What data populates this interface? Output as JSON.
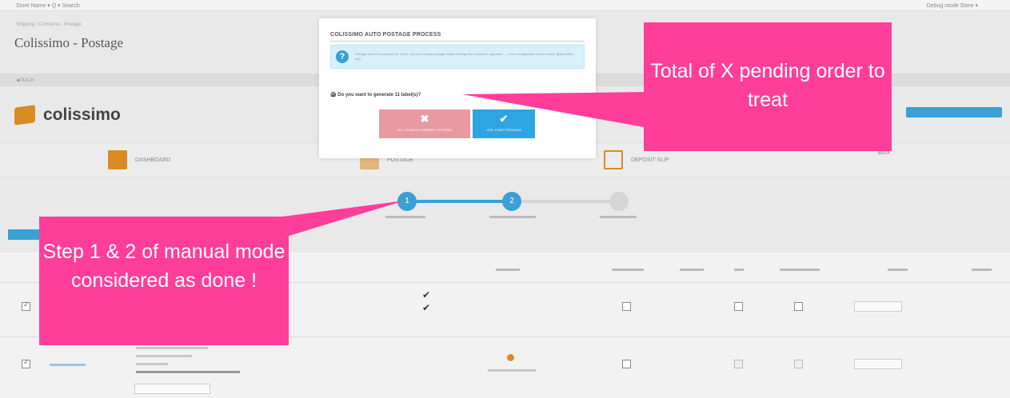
{
  "topbar": {
    "shop_label": "Store Name ▾   Q ▾   Search",
    "right_label": "Debug mode   Store ▾"
  },
  "breadcrumb": "Shipping  /  Colissimo - Postage",
  "page_title": "Colissimo - Postage",
  "subbar_label": "◀ BACK",
  "logo_text": "colissimo",
  "tabs": [
    {
      "label": "DASHBOARD",
      "icon": "dashboard-icon"
    },
    {
      "label": "POSTAGE",
      "icon": "postage-icon"
    },
    {
      "label": "DEPOSIT SLIP",
      "icon": "deposit-slip-icon"
    },
    {
      "label": "BOX",
      "icon": "box-icon"
    }
  ],
  "steps": [
    "1",
    "2",
    ""
  ],
  "modal": {
    "title": "COLISSIMO AUTO POSTAGE PROCESS",
    "info_text": "Postage mode is configured to \"Auto\". You can change postage default settings like insurance, signature, ... in the configuration of the module (Back-Office tab).",
    "info_icon": "question-icon",
    "question": "🖨 Do you want to generate 11 label(s)?",
    "no_glyph": "✖",
    "no_label": "NO, GO BACK SHIPMENT OPTIONS",
    "yes_glyph": "✔",
    "yes_label": "YES, START PROCESS"
  },
  "callouts": {
    "pending": "Total of X pending order to treat",
    "steps": "Step 1 & 2 of manual mode considered as done !"
  },
  "colors": {
    "callout": "#ff3e9a",
    "accent": "#3aa0d6",
    "brand": "#d98c22",
    "danger_soft": "#e89aa0"
  }
}
